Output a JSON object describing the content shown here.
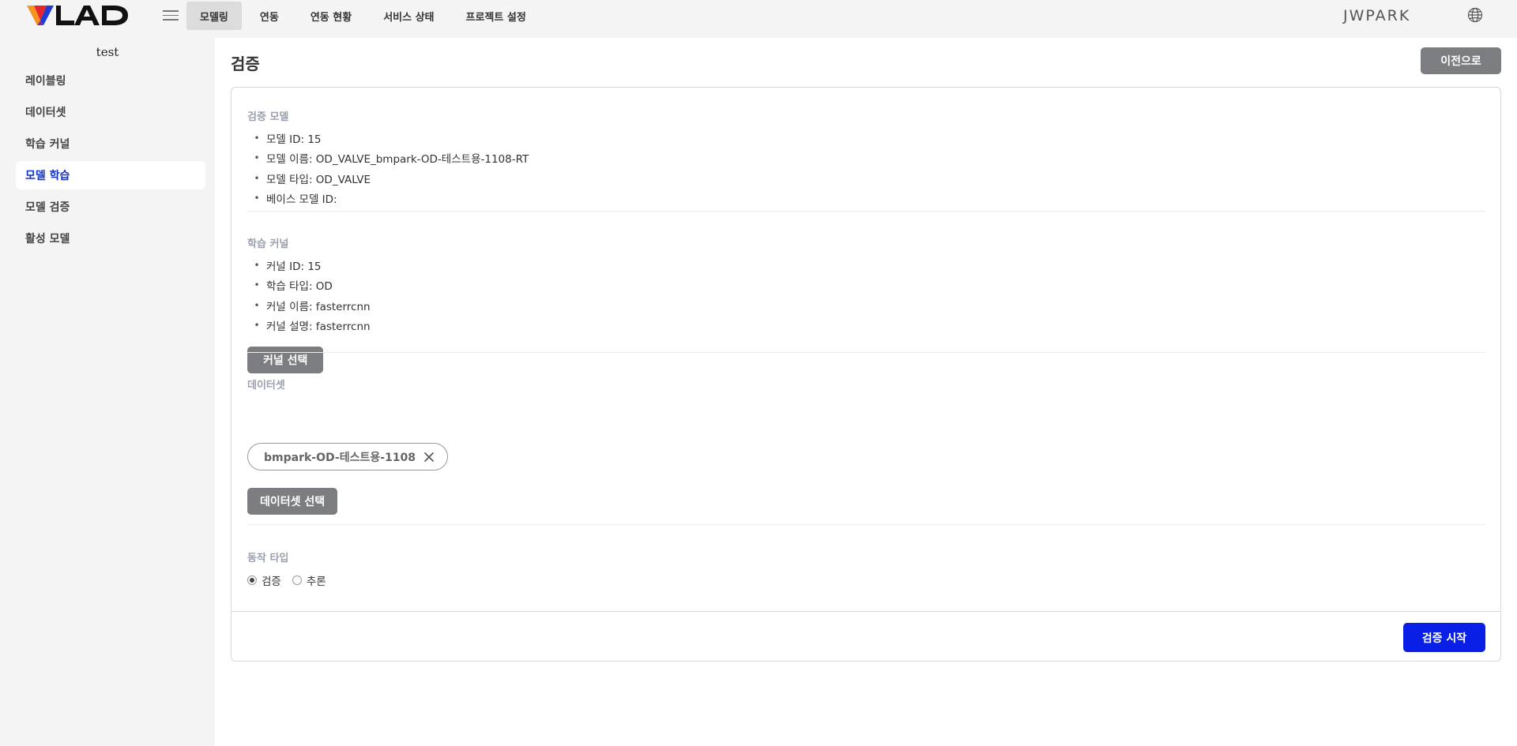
{
  "header": {
    "logo_text": "VLAD",
    "nav": [
      {
        "label": "모델링",
        "active": true
      },
      {
        "label": "연동",
        "active": false
      },
      {
        "label": "연동 현황",
        "active": false
      },
      {
        "label": "서비스 상태",
        "active": false
      },
      {
        "label": "프로젝트 설정",
        "active": false
      }
    ],
    "user": "JWPARK",
    "icons": {
      "menu": "hamburger-icon",
      "language": "globe-icon"
    }
  },
  "sidebar": {
    "project": "test",
    "items": [
      {
        "label": "레이블링",
        "active": false
      },
      {
        "label": "데이터셋",
        "active": false
      },
      {
        "label": "학습 커널",
        "active": false
      },
      {
        "label": "모델 학습",
        "active": true
      },
      {
        "label": "모델 검증",
        "active": false
      },
      {
        "label": "활성 모델",
        "active": false
      }
    ]
  },
  "main": {
    "title": "검증",
    "back_label": "이전으로",
    "model_section": {
      "title": "검증 모델",
      "items": [
        "모델 ID: 15",
        "모델 이름: OD_VALVE_bmpark-OD-테스트용-1108-RT",
        "모델 타입: OD_VALVE",
        "베이스 모델 ID:"
      ]
    },
    "kernel_section": {
      "title": "학습 커널",
      "items": [
        "커널 ID: 15",
        "학습 타입: OD",
        "커널 이름: fasterrcnn",
        "커널 설명: fasterrcnn"
      ],
      "button_label": "커널 선택"
    },
    "dataset_section": {
      "title": "데이터셋",
      "chip_label": "bmpark-OD-테스트용-1108",
      "button_label": "데이터셋 선택"
    },
    "action_section": {
      "title": "동작 타입",
      "options": [
        {
          "label": "검증",
          "checked": true
        },
        {
          "label": "추론",
          "checked": false
        }
      ]
    },
    "start_label": "검증 시작"
  },
  "colors": {
    "accent": "#0a1fe6",
    "active_sidebar_text": "#1133cc",
    "gray_button": "#7c7d80",
    "section_title": "#9aa0ae"
  }
}
